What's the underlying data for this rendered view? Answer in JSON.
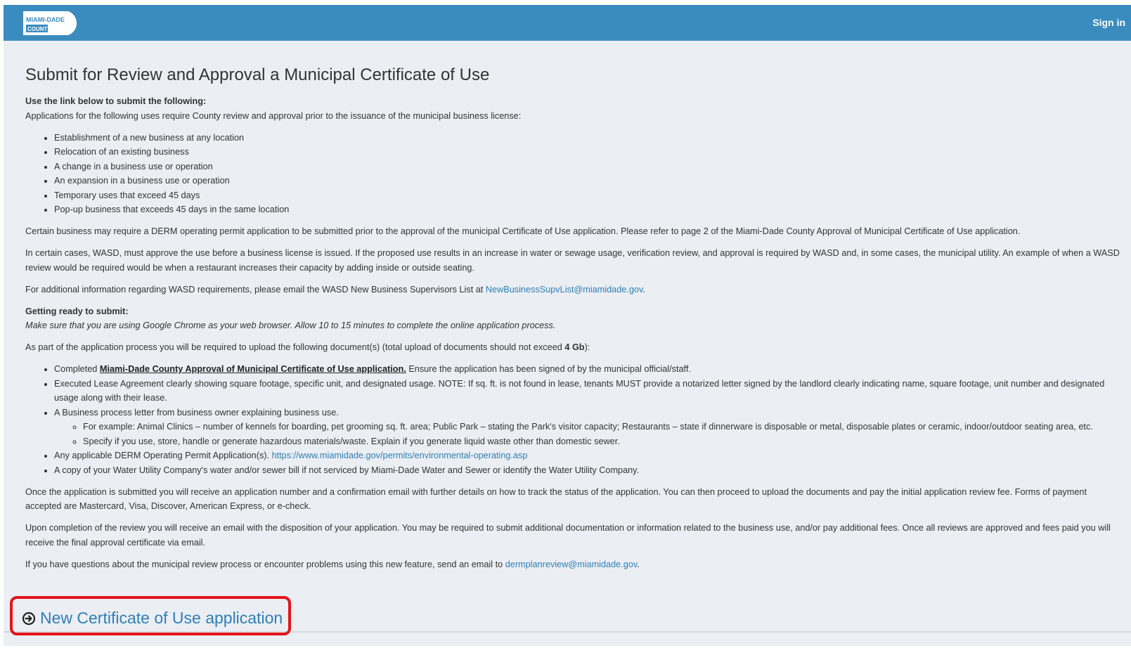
{
  "header": {
    "logo_top": "MIAMI-DADE",
    "logo_bottom": "COUNTY",
    "signin": "Sign in",
    "bar_color": "#3a8cbf"
  },
  "main": {
    "title": "Submit for Review and Approval a Municipal Certificate of Use",
    "submit_heading": "Use the link below to submit the following:",
    "intro": "Applications for the following uses require County review and approval prior to the issuance of the municipal business license:",
    "uses": [
      "Establishment of a new business at any location",
      "Relocation of an existing business",
      "A change in a business use or operation",
      "An expansion in a business use or operation",
      "Temporary uses that exceed 45 days",
      "Pop-up business that exceeds 45 days in the same location"
    ],
    "derm_para": "Certain business may require a DERM operating permit application to be submitted prior to the approval of the municipal Certificate of Use application. Please refer to page 2 of the Miami-Dade County Approval of Municipal Certificate of Use application.",
    "wasd_para": "In certain cases, WASD, must approve the use before a business license is issued. If the proposed use results in an increase in water or sewage usage, verification review, and approval is required by WASD and, in some cases, the municipal utility. An example of when a WASD review would be required would be when a restaurant increases their capacity by adding inside or outside seating.",
    "wasd_email_pre": "For additional information regarding WASD requirements, please email the WASD New Business Supervisors List at ",
    "wasd_email": "NewBusinessSupvList@miamidade.gov",
    "wasd_email_post": ".",
    "ready_heading": "Getting ready to submit:",
    "ready_note": "Make sure that you are using Google Chrome as your web browser. Allow 10 to 15 minutes to complete the online application process.",
    "upload_pre": "As part of the application process you will be required to upload the following document(s) (total upload of documents should not exceed ",
    "upload_limit": "4 Gb",
    "upload_post": "):",
    "doc1_pre": "Completed ",
    "doc1_link": "Miami-Dade County Approval of Municipal Certificate of Use application.",
    "doc1_post": " Ensure the application has been signed of by the municipal official/staff.",
    "doc2": "Executed Lease Agreement clearly showing square footage, specific unit, and designated usage. NOTE: If sq. ft. is not found in lease, tenants MUST provide a notarized letter signed by the landlord clearly indicating name, square footage, unit number and designated usage along with their lease.",
    "doc3": "A Business process letter from business owner explaining business use.",
    "doc3_sub1": "For example: Animal Clinics – number of kennels for boarding, pet grooming sq. ft. area; Public Park – stating the Park's visitor capacity; Restaurants – state if dinnerware is disposable or metal, disposable plates or ceramic, indoor/outdoor seating area, etc.",
    "doc3_sub2": "Specify if you use, store, handle or generate hazardous materials/waste. Explain if you generate liquid waste other than domestic sewer.",
    "doc4_pre": "Any applicable DERM Operating Permit Application(s). ",
    "doc4_link": "https://www.miamidade.gov/permits/environmental-operating.asp",
    "doc5": "A copy of your Water Utility Company's water and/or sewer bill if not serviced by Miami-Dade Water and Sewer or identify the Water Utility Company.",
    "submitted_para": "Once the application is submitted you will receive an application number and a confirmation email with further details on how to track the status of the application. You can then proceed to upload the documents and pay the initial application review fee. Forms of payment accepted are Mastercard, Visa, Discover, American Express, or e-check.",
    "completion_para": "Upon completion of the review you will receive an email with the disposition of your application. You may be required to submit additional documentation or information related to the business use, and/or pay additional fees. Once all reviews are approved and fees paid you will receive the final approval certificate via email.",
    "questions_pre": "If you have questions about the municipal review process or encounter problems using this new feature, send an email to ",
    "questions_email": "dermplanreview@miamidade.gov",
    "questions_post": ".",
    "cta_label": "New Certificate of Use application",
    "link_color": "#2f7fb3",
    "highlight_color": "#e3151a"
  }
}
